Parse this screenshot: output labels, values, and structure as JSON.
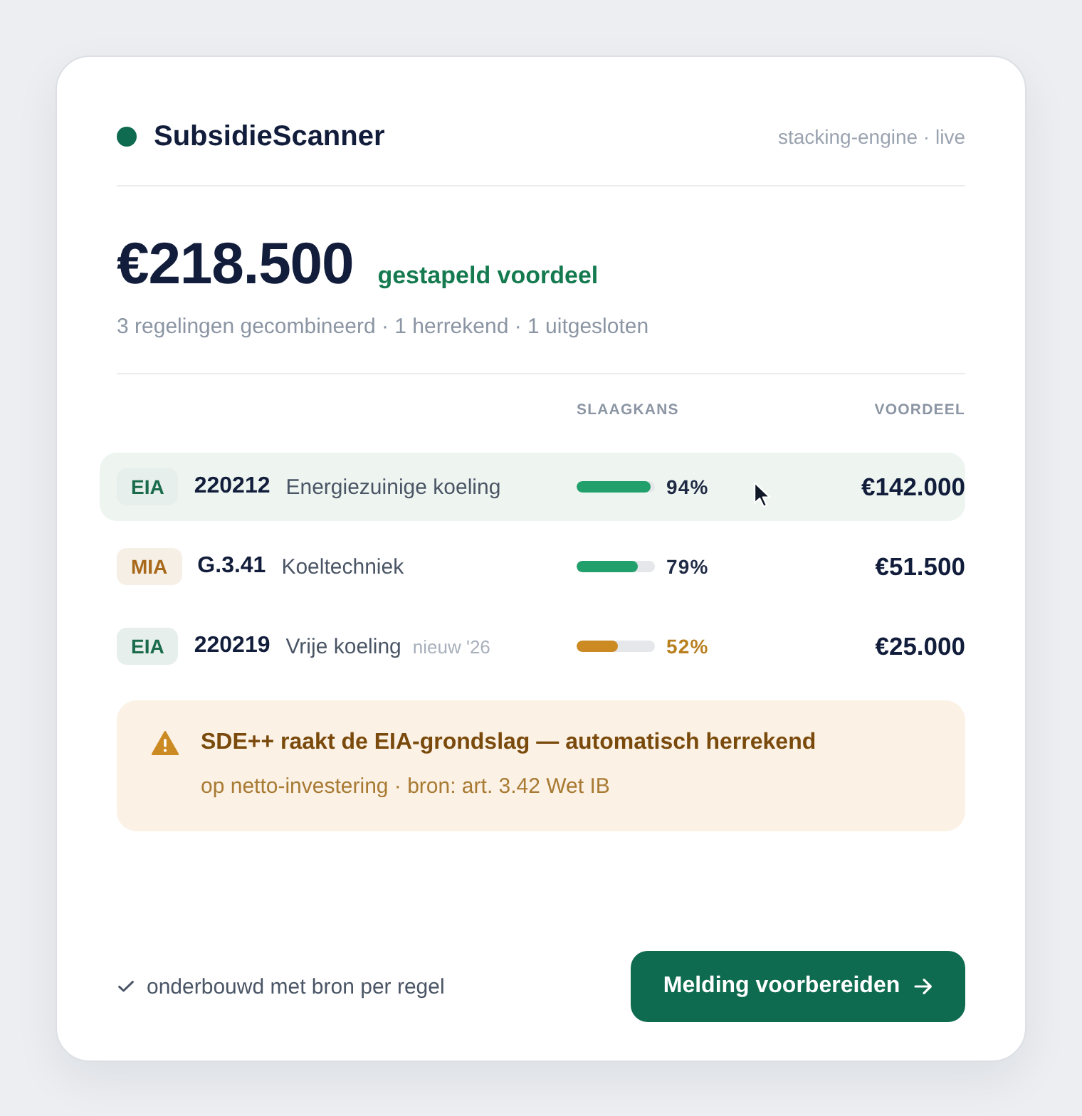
{
  "header": {
    "title": "SubsidieScanner",
    "status": "stacking-engine · live"
  },
  "summary": {
    "amount": "€218.500",
    "label": "gestapeld voordeel",
    "details": "3 regelingen gecombineerd · 1 herrekend · 1 uitgesloten"
  },
  "table": {
    "columns": [
      "SLAAGKANS",
      "VOORDEEL"
    ],
    "rows": [
      {
        "scheme": "EIA",
        "color": "#1a6b4c",
        "code": "220212",
        "name": "Energiezuinige koeling",
        "level": 0.94,
        "chance": "94%",
        "warning": false,
        "benefit": "€142.000",
        "selected": true
      },
      {
        "scheme": "MIA",
        "color": "#a8691a",
        "code": "G.3.41",
        "name": "Koeltechniek",
        "level": 0.79,
        "chance": "79%",
        "warning": false,
        "benefit": "€51.500",
        "selected": false
      },
      {
        "scheme": "EIA",
        "color": "#1a6b4c",
        "code": "220219",
        "name": "Vrije koeling",
        "note": "nieuw '26",
        "level": 0.52,
        "chance": "52%",
        "warning": true,
        "benefit": "€25.000",
        "selected": false
      }
    ]
  },
  "alert": {
    "title": "SDE++ raakt de EIA-grondslag — automatisch herrekend",
    "detail": "op netto-investering · bron: art. 3.42 Wet IB"
  },
  "footer": {
    "note": "onderbouwd met bron per regel",
    "button": "Melding voorbereiden"
  }
}
